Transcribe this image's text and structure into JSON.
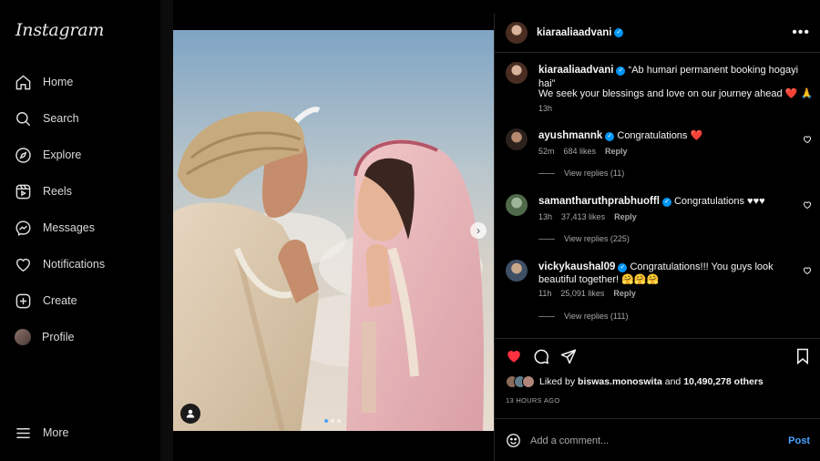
{
  "sidebar": {
    "logo": "Instagram",
    "items": [
      {
        "label": "Home",
        "icon": "home-icon"
      },
      {
        "label": "Search",
        "icon": "search-icon"
      },
      {
        "label": "Explore",
        "icon": "compass-icon"
      },
      {
        "label": "Reels",
        "icon": "reels-icon"
      },
      {
        "label": "Messages",
        "icon": "messenger-icon"
      },
      {
        "label": "Notifications",
        "icon": "heart-icon"
      },
      {
        "label": "Create",
        "icon": "plus-square-icon"
      },
      {
        "label": "Profile",
        "icon": "avatar"
      }
    ],
    "more_label": "More"
  },
  "post": {
    "author": "kiaraaliaadvani",
    "caption_author": "kiaraaliaadvani",
    "caption_line1": "“Ab humari permanent booking hogayi hai”",
    "caption_line2": "We seek your blessings and love on our journey ahead ❤️ 🙏",
    "caption_time": "13h",
    "likes_prefix": "Liked by",
    "liked_by_user": "biswas.monoswita",
    "likes_and": "and",
    "likes_count": "10,490,278 others",
    "post_time": "13 HOURS AGO",
    "comment_placeholder": "Add a comment...",
    "post_button": "Post",
    "more_icon": "more-horizontal-icon",
    "carousel": {
      "slides": 3,
      "current": 1
    }
  },
  "comments": [
    {
      "user": "ayushmannk",
      "text": "Congratulations ❤️",
      "time": "52m",
      "likes": "684 likes",
      "reply": "Reply",
      "view_replies": "View replies (11)"
    },
    {
      "user": "samantharuthprabhuoffl",
      "text": "Congratulations ♥♥♥",
      "time": "13h",
      "likes": "37,413 likes",
      "reply": "Reply",
      "view_replies": "View replies (225)"
    },
    {
      "user": "vickykaushal09",
      "text": "Congratulations!!! You guys look beautiful together! 🤗🤗🤗",
      "time": "11h",
      "likes": "25,091 likes",
      "reply": "Reply",
      "view_replies": "View replies (111)"
    }
  ],
  "colors": {
    "accent": "#0095f6",
    "like_red": "#ff3040",
    "background": "#000000",
    "divider": "#262626"
  }
}
